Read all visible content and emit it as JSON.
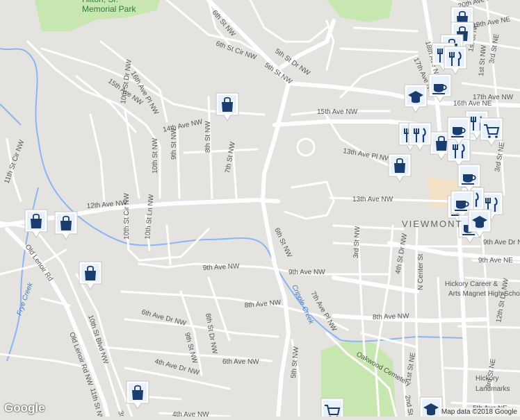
{
  "map": {
    "attribution": "Map data ©2018 Google",
    "logo": "Google",
    "neighborhood": "VIEWMONT",
    "park": "Hilton, Sr. Memorial Park",
    "streets": [
      {
        "text": "6th St NW"
      },
      {
        "text": "6th St Cir NW"
      },
      {
        "text": "5th St Dr NW"
      },
      {
        "text": "5th St NW"
      },
      {
        "text": "15th Ave NW"
      },
      {
        "text": "16th Ave Pl NW"
      },
      {
        "text": "10th St Dr NW"
      },
      {
        "text": "14th Ave NW"
      },
      {
        "text": "8th St NW"
      },
      {
        "text": "7th St NW"
      },
      {
        "text": "9th St NW"
      },
      {
        "text": "10th St NW"
      },
      {
        "text": "11th St Cir NW"
      },
      {
        "text": "12th Ave NW"
      },
      {
        "text": "10th St Cir NW"
      },
      {
        "text": "10th St Ln NW"
      },
      {
        "text": "6th St NW"
      },
      {
        "text": "9th Ave NW"
      },
      {
        "text": "9th Ave NW"
      },
      {
        "text": "8th Ave NW"
      },
      {
        "text": "7th Ave Pl NW"
      },
      {
        "text": "8th Ave NW"
      },
      {
        "text": "13th Ave Pl NW"
      },
      {
        "text": "13th Ave NW"
      },
      {
        "text": "3rd St NW"
      },
      {
        "text": "4th St Dr NW"
      },
      {
        "text": "N Center St"
      },
      {
        "text": "1st St NW"
      },
      {
        "text": "Old Lenoir Rd"
      },
      {
        "text": "Old Lenoir Rd NW"
      },
      {
        "text": "10th St Blvd NW"
      },
      {
        "text": "11th St NW"
      },
      {
        "text": "6th Ave Dr NW"
      },
      {
        "text": "9th St NW"
      },
      {
        "text": "8th St Dr NW"
      },
      {
        "text": "6th Ave NW"
      },
      {
        "text": "4th Ave Dr NW"
      },
      {
        "text": "4th Ave NW"
      },
      {
        "text": "5th St NW"
      },
      {
        "text": "16th Ave NE"
      },
      {
        "text": "20th Ave NE"
      },
      {
        "text": "19th Ave NE"
      },
      {
        "text": "17th Ave NE"
      },
      {
        "text": "18th Ave NE"
      },
      {
        "text": "1st St NE"
      },
      {
        "text": "3rd St NE"
      },
      {
        "text": "3rd St NE"
      },
      {
        "text": "9th Ave Dr NE"
      },
      {
        "text": "9th Ave NE"
      },
      {
        "text": "17th Ave NW"
      },
      {
        "text": "15th Ave NW"
      },
      {
        "text": "12th St Dr NW"
      },
      {
        "text": "3rd St NE"
      },
      {
        "text": "1st St NE"
      },
      {
        "text": "5th Ave NE"
      },
      {
        "text": "3rd"
      },
      {
        "text": "2nd St NE"
      }
    ],
    "creeks": [
      "Cripple Creek",
      "Frye Creek"
    ],
    "places": [
      {
        "text": "Hickory Career & Arts Magnet High School"
      },
      {
        "text": "Hickory Landmarks"
      },
      {
        "text": "Oakwood Cemetery"
      }
    ],
    "markers": [
      {
        "type": "shopping",
        "icon": "shopping-bag-icon"
      },
      {
        "type": "shopping",
        "icon": "shopping-bag-icon"
      },
      {
        "type": "shopping",
        "icon": "shopping-bag-icon"
      },
      {
        "type": "shopping",
        "icon": "shopping-bag-icon"
      },
      {
        "type": "shopping",
        "icon": "shopping-bag-icon"
      },
      {
        "type": "shopping",
        "icon": "shopping-bag-icon"
      },
      {
        "type": "shopping",
        "icon": "shopping-bag-icon"
      },
      {
        "type": "shopping",
        "icon": "shopping-bag-icon"
      },
      {
        "type": "shopping",
        "icon": "shopping-bag-icon"
      },
      {
        "type": "shopping",
        "icon": "shopping-bag-icon"
      },
      {
        "type": "restaurant",
        "icon": "fork-knife-icon"
      },
      {
        "type": "restaurant",
        "icon": "fork-knife-icon"
      },
      {
        "type": "restaurant",
        "icon": "fork-knife-icon"
      },
      {
        "type": "restaurant",
        "icon": "fork-knife-icon"
      },
      {
        "type": "restaurant",
        "icon": "fork-knife-icon"
      },
      {
        "type": "restaurant",
        "icon": "fork-knife-icon"
      },
      {
        "type": "restaurant",
        "icon": "fork-knife-icon"
      },
      {
        "type": "restaurant",
        "icon": "fork-knife-icon"
      },
      {
        "type": "restaurant",
        "icon": "fork-knife-icon"
      },
      {
        "type": "cafe",
        "icon": "coffee-cup-icon"
      },
      {
        "type": "cafe",
        "icon": "coffee-cup-icon"
      },
      {
        "type": "cafe",
        "icon": "coffee-cup-icon"
      },
      {
        "type": "cafe",
        "icon": "coffee-cup-icon"
      },
      {
        "type": "cafe",
        "icon": "coffee-cup-icon"
      },
      {
        "type": "cafe",
        "icon": "coffee-cup-icon"
      },
      {
        "type": "school",
        "icon": "graduation-cap-icon"
      },
      {
        "type": "school",
        "icon": "graduation-cap-icon"
      },
      {
        "type": "school",
        "icon": "graduation-cap-icon"
      },
      {
        "type": "grocery",
        "icon": "shopping-cart-icon"
      },
      {
        "type": "grocery",
        "icon": "shopping-cart-icon"
      }
    ],
    "colors": {
      "background": "#e5e3df",
      "road": "#ffffff",
      "park": "#c8e6b0",
      "water": "#8ab4f8",
      "marker": "#1a5a96",
      "downtown": "#f3e1c8"
    }
  }
}
